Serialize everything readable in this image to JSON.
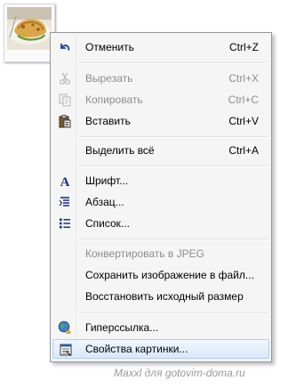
{
  "menu": {
    "undo": {
      "label": "Отменить",
      "shortcut": "Ctrl+Z",
      "icon": "undo-arrow-icon"
    },
    "cut": {
      "label": "Вырезать",
      "shortcut": "Ctrl+X",
      "icon": "scissors-icon",
      "disabled": true
    },
    "copy": {
      "label": "Копировать",
      "shortcut": "Ctrl+C",
      "icon": "copy-icon",
      "disabled": true
    },
    "paste": {
      "label": "Вставить",
      "shortcut": "Ctrl+V",
      "icon": "clipboard-icon"
    },
    "select_all": {
      "label": "Выделить всё",
      "shortcut": "Ctrl+A"
    },
    "font": {
      "label": "Шрифт...",
      "icon": "font-a-icon"
    },
    "paragraph": {
      "label": "Абзац...",
      "icon": "paragraph-icon"
    },
    "list": {
      "label": "Список...",
      "icon": "bullet-list-icon"
    },
    "convert_jpeg": {
      "label": "Конвертировать в JPEG",
      "disabled": true
    },
    "save_image": {
      "label": "Сохранить изображение в файл..."
    },
    "restore_size": {
      "label": "Восстановить исходный размер"
    },
    "hyperlink": {
      "label": "Гиперссылка...",
      "icon": "globe-link-icon"
    },
    "image_properties": {
      "label": "Свойства картинки...",
      "icon": "properties-icon",
      "highlighted": true
    }
  },
  "watermark": "Maxxl для gotovim-doma.ru",
  "colors": {
    "menu_bg": "#f5f5f5",
    "menu_border": "#979797",
    "disabled_text": "#8d8d8d",
    "highlight_top": "#f1f6fd",
    "highlight_bottom": "#dae8fa",
    "highlight_border": "#aecff7"
  }
}
